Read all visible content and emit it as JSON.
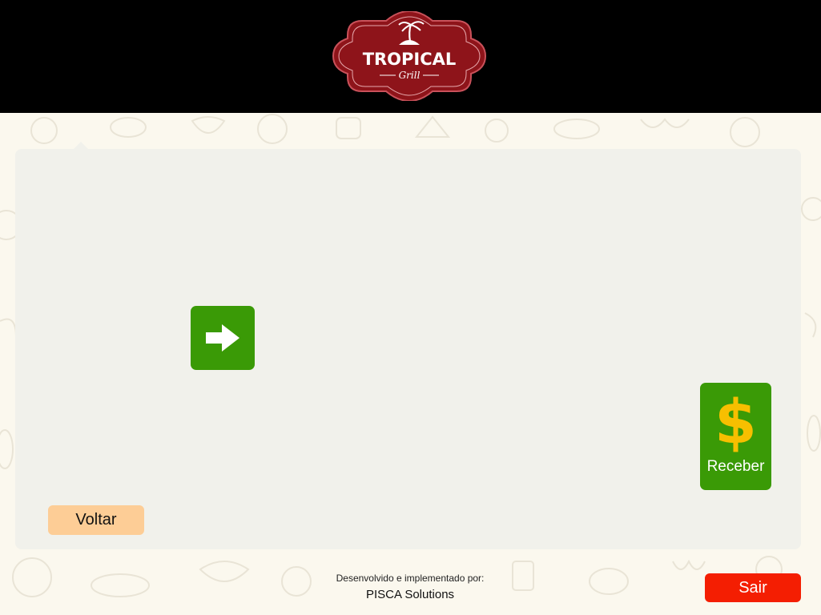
{
  "header": {
    "logo_title": "TROPICAL",
    "logo_subtitle": "Grill"
  },
  "actions": {
    "next_icon": "arrow-right-icon",
    "receber": {
      "icon": "dollar-icon",
      "symbol": "$",
      "label": "Receber"
    },
    "voltar_label": "Voltar",
    "sair_label": "Sair"
  },
  "footer": {
    "credit_prefix": "Desenvolvido e implementado por:",
    "credit_company": "PISCA Solutions"
  },
  "colors": {
    "header_bg": "#000000",
    "logo_red": "#8e141a",
    "panel_bg": "#f1f1eb",
    "action_green": "#3a9a06",
    "dollar_yellow": "#f7bf00",
    "voltar_bg": "#fdcd96",
    "sair_bg": "#f41e02"
  }
}
